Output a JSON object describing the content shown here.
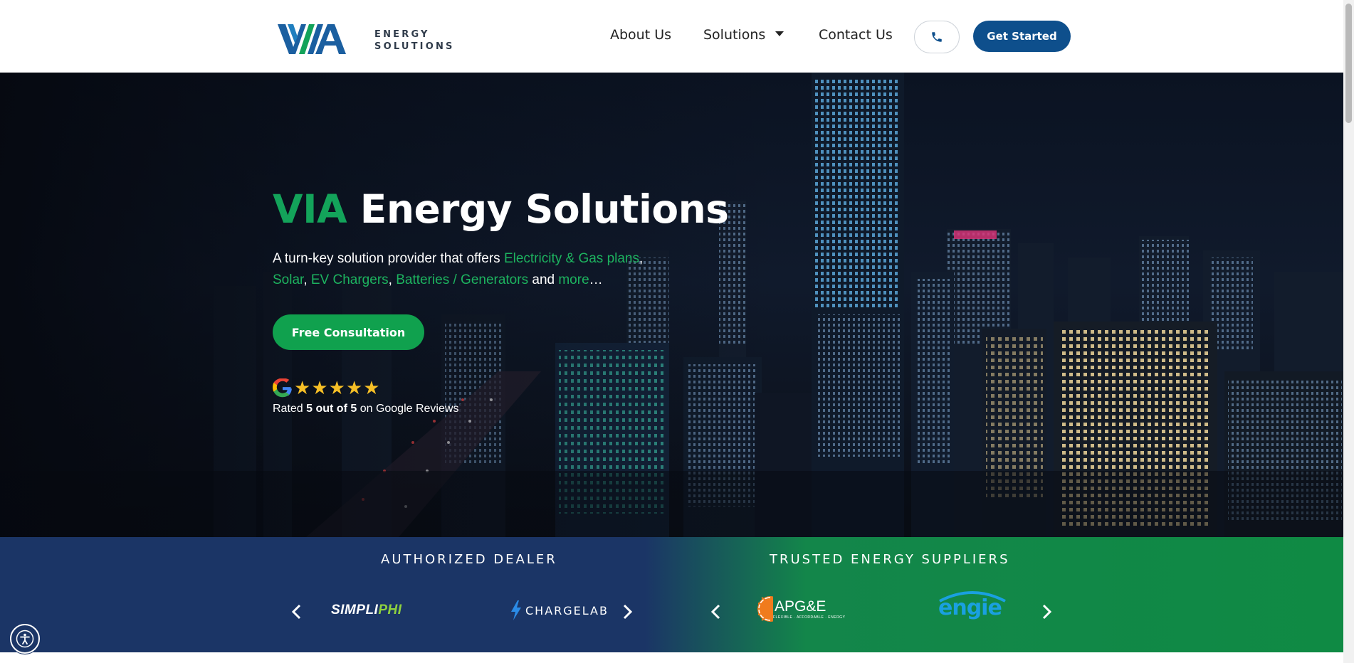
{
  "header": {
    "logo_mark": "VIA",
    "logo_line1": "ENERGY",
    "logo_line2": "SOLUTIONS",
    "nav": {
      "about": "About Us",
      "solutions": "Solutions",
      "contact": "Contact Us"
    },
    "phone_icon": "phone-icon",
    "cta": "Get Started"
  },
  "hero": {
    "title_accent": "VIA",
    "title_rest": " Energy Solutions",
    "desc_intro": "A turn-key solution provider that offers ",
    "link_electricity": "Electricity & Gas plans",
    "comma1": ",",
    "link_solar": "Solar",
    "comma2": ", ",
    "link_ev": "EV Chargers",
    "comma3": ", ",
    "link_batteries": "Batteries / Generators",
    "and_text": " and ",
    "link_more": "more",
    "ellipsis": "…",
    "consult_button": "Free Consultation",
    "stars_count": 5,
    "rating_prefix": "Rated ",
    "rating_value": "5 out of 5",
    "rating_suffix": " on Google Reviews"
  },
  "partners": {
    "dealer_title": "AUTHORIZED DEALER",
    "suppliers_title": "TRUSTED ENERGY SUPPLIERS",
    "dealers": {
      "simpliphi_main": "SIMPLI",
      "simpliphi_accent": "PHI",
      "chargelab": "CHARGELAB"
    },
    "suppliers": {
      "apge": "APG&E",
      "apge_tagline": "FLEXIBLE · AFFORDABLE · ENERGY",
      "engie": "engie"
    }
  },
  "colors": {
    "brand_blue": "#0e4f8c",
    "brand_green": "#10a14e",
    "strip_navy": "#1b3566",
    "star_gold": "#f6bf26"
  }
}
